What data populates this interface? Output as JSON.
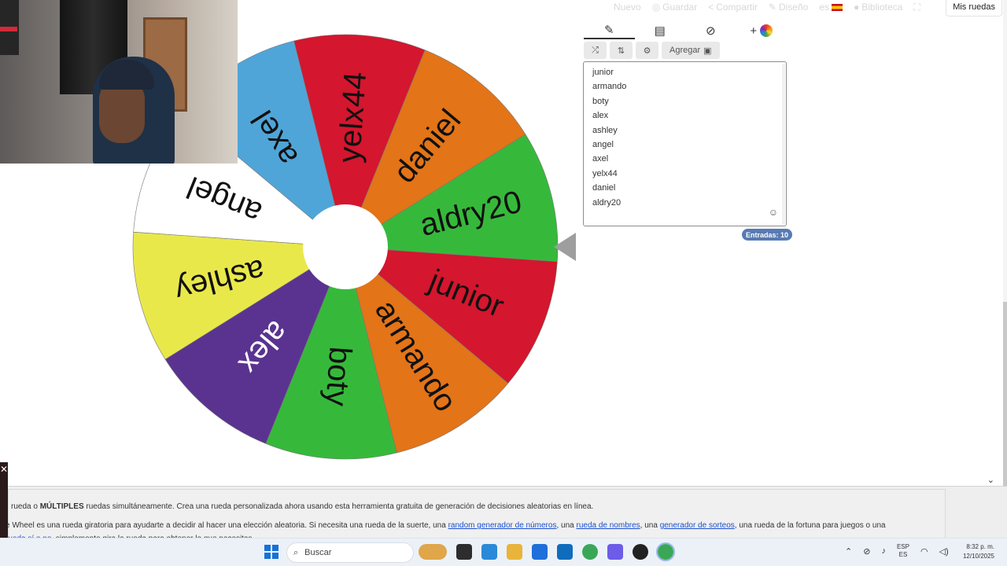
{
  "topnav": {
    "items": [
      "Nuevo",
      "Guardar",
      "Compartir",
      "Diseño",
      "es",
      "Biblioteca"
    ],
    "my_wheels": "Mis ruedas"
  },
  "wheel": {
    "segments": [
      {
        "label": "junior",
        "color": "#D4162E"
      },
      {
        "label": "armando",
        "color": "#E37417"
      },
      {
        "label": "boty",
        "color": "#36B93B"
      },
      {
        "label": "alex",
        "color": "#5A3390"
      },
      {
        "label": "ashley",
        "color": "#E9E84B"
      },
      {
        "label": "angel",
        "color": "#FFFFFF"
      },
      {
        "label": "axel",
        "color": "#4FA5D8"
      },
      {
        "label": "yelx44",
        "color": "#D4162E"
      },
      {
        "label": "daniel",
        "color": "#E37417"
      },
      {
        "label": "aldry20",
        "color": "#36B93B"
      }
    ],
    "pointer_color": "#9E9E9E"
  },
  "editor": {
    "tabs": [
      "pencil-icon",
      "clipboard-icon",
      "eye-slash-icon",
      "add-wheel-icon"
    ],
    "add_symbol": "+",
    "add_button": "Agregar",
    "entries": [
      "junior",
      "armando",
      "boty",
      "alex",
      "ashley",
      "angel",
      "axel",
      "yelx44",
      "daniel",
      "aldry20"
    ],
    "count_badge": "Entradas: 10"
  },
  "description": {
    "p1_a": "rueda o ",
    "p1_bold": "MÚLTIPLES",
    "p1_b": " ruedas simultáneamente. Crea una rueda personalizada ahora usando esta herramienta gratuita de generación de decisiones aleatorias en línea.",
    "p2_a": "e Wheel es una rueda giratoria para ayudarte a decidir al hacer una elección aleatoria. Si necesita una rueda de la suerte, una ",
    "p2_link1": "random generador de números",
    "p2_b": ", una ",
    "p2_link2": "rueda de nombres",
    "p2_c": ", una ",
    "p2_link3": "generador de sorteos",
    "p2_d": ", una rueda de la fortuna para juegos o una",
    "p3_link": "rueda sí o no",
    "p3_a": ", simplemente gira la rueda para obtener lo que necesitas."
  },
  "taskbar": {
    "search_placeholder": "Buscar",
    "lang_top": "ESP",
    "lang_bottom": "ES",
    "time": "8:32 p. m.",
    "date": "12/10/2025"
  }
}
